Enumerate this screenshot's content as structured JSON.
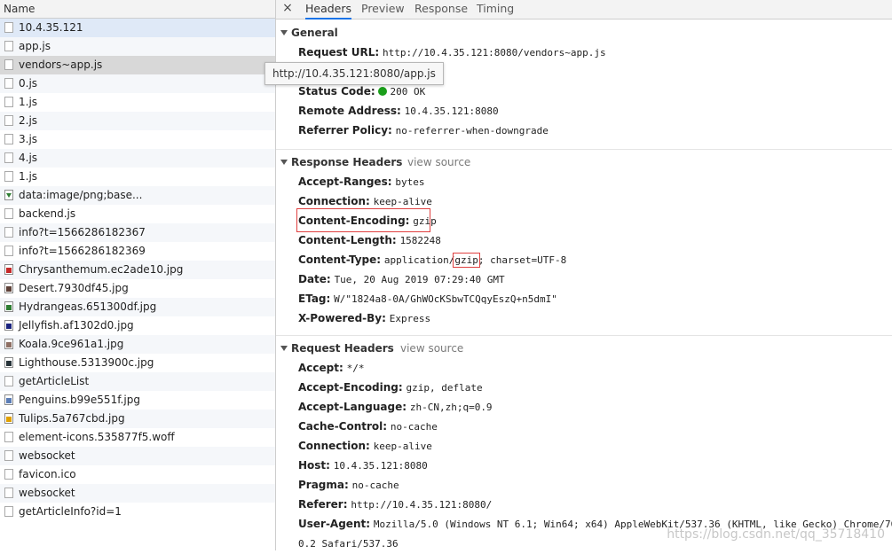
{
  "left": {
    "header": "Name",
    "items": [
      {
        "label": "10.4.35.121",
        "icon": "document-icon"
      },
      {
        "label": "app.js",
        "icon": "document-icon"
      },
      {
        "label": "vendors~app.js",
        "icon": "document-icon"
      },
      {
        "label": "0.js",
        "icon": "document-icon"
      },
      {
        "label": "1.js",
        "icon": "document-icon"
      },
      {
        "label": "2.js",
        "icon": "document-icon"
      },
      {
        "label": "3.js",
        "icon": "document-icon"
      },
      {
        "label": "4.js",
        "icon": "document-icon"
      },
      {
        "label": "1.js",
        "icon": "document-icon"
      },
      {
        "label": "data:image/png;base...",
        "icon": "image-icon"
      },
      {
        "label": "backend.js",
        "icon": "document-icon"
      },
      {
        "label": "info?t=1566286182367",
        "icon": "document-icon"
      },
      {
        "label": "info?t=1566286182369",
        "icon": "document-icon"
      },
      {
        "label": "Chrysanthemum.ec2ade10.jpg",
        "icon": "image-icon"
      },
      {
        "label": "Desert.7930df45.jpg",
        "icon": "image-icon"
      },
      {
        "label": "Hydrangeas.651300df.jpg",
        "icon": "image-icon"
      },
      {
        "label": "Jellyfish.af1302d0.jpg",
        "icon": "image-icon"
      },
      {
        "label": "Koala.9ce961a1.jpg",
        "icon": "image-icon"
      },
      {
        "label": "Lighthouse.5313900c.jpg",
        "icon": "image-icon"
      },
      {
        "label": "getArticleList",
        "icon": "document-icon"
      },
      {
        "label": "Penguins.b99e551f.jpg",
        "icon": "image-icon"
      },
      {
        "label": "Tulips.5a767cbd.jpg",
        "icon": "image-icon"
      },
      {
        "label": "element-icons.535877f5.woff",
        "icon": "document-icon"
      },
      {
        "label": "websocket",
        "icon": "document-icon"
      },
      {
        "label": "favicon.ico",
        "icon": "document-icon"
      },
      {
        "label": "websocket",
        "icon": "document-icon"
      },
      {
        "label": "getArticleInfo?id=1",
        "icon": "document-icon"
      }
    ],
    "tooltip": "http://10.4.35.121:8080/app.js"
  },
  "tabs": {
    "close": "×",
    "items": [
      "Headers",
      "Preview",
      "Response",
      "Timing"
    ],
    "active": "Headers"
  },
  "general": {
    "title": "General",
    "rows": [
      {
        "name": "Request URL:",
        "value": "http://10.4.35.121:8080/vendors~app.js"
      },
      {
        "name": "Status Code:",
        "value": "200 OK"
      },
      {
        "name": "Remote Address:",
        "value": "10.4.35.121:8080"
      },
      {
        "name": "Referrer Policy:",
        "value": "no-referrer-when-downgrade"
      }
    ]
  },
  "response_headers": {
    "title": "Response Headers",
    "view_source": "view source",
    "rows": [
      {
        "name": "Accept-Ranges:",
        "value": "bytes"
      },
      {
        "name": "Connection:",
        "value": "keep-alive"
      },
      {
        "name": "Content-Encoding:",
        "value": "gzip"
      },
      {
        "name": "Content-Length:",
        "value": "1582248"
      },
      {
        "name": "Content-Type:",
        "value_a": "application/",
        "value_b": "gzip",
        "value_c": "; charset=UTF-8"
      },
      {
        "name": "Date:",
        "value": "Tue, 20 Aug 2019 07:29:40 GMT"
      },
      {
        "name": "ETag:",
        "value": "W/\"1824a8-0A/GhWOcKSbwTCQqyEszQ+n5dmI\""
      },
      {
        "name": "X-Powered-By:",
        "value": "Express"
      }
    ]
  },
  "request_headers": {
    "title": "Request Headers",
    "view_source": "view source",
    "rows": [
      {
        "name": "Accept:",
        "value": "*/*"
      },
      {
        "name": "Accept-Encoding:",
        "value": "gzip, deflate"
      },
      {
        "name": "Accept-Language:",
        "value": "zh-CN,zh;q=0.9"
      },
      {
        "name": "Cache-Control:",
        "value": "no-cache"
      },
      {
        "name": "Connection:",
        "value": "keep-alive"
      },
      {
        "name": "Host:",
        "value": "10.4.35.121:8080"
      },
      {
        "name": "Pragma:",
        "value": "no-cache"
      },
      {
        "name": "Referer:",
        "value": "http://10.4.35.121:8080/"
      },
      {
        "name": "User-Agent:",
        "value": "Mozilla/5.0 (Windows NT 6.1; Win64; x64) AppleWebKit/537.36 (KHTML, like Gecko) Chrome/70.0"
      },
      {
        "name": "",
        "value": "0.2 Safari/537.36"
      }
    ]
  },
  "watermark": "https://blog.csdn.net/qq_35718410",
  "colors": {
    "accent": "#1a73e8",
    "status_ok": "#1a9e1a",
    "highlight_box": "#e04040"
  }
}
